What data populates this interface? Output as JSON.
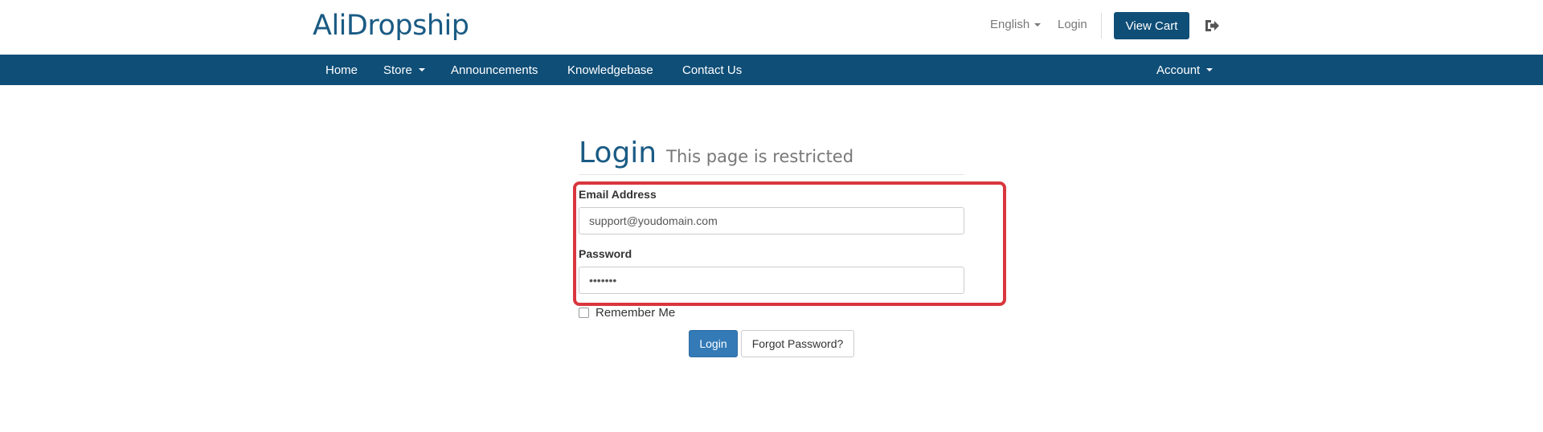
{
  "header": {
    "logo": "AliDropship",
    "language": "English",
    "login_link": "Login",
    "view_cart": "View Cart",
    "logout_icon": "sign-out-icon"
  },
  "nav": {
    "items": [
      {
        "label": "Home"
      },
      {
        "label": "Store",
        "dropdown": true
      },
      {
        "label": "Announcements"
      },
      {
        "label": "Knowledgebase"
      },
      {
        "label": "Contact Us"
      }
    ],
    "account": "Account"
  },
  "login": {
    "title": "Login",
    "subtitle": "This page is restricted",
    "email_label": "Email Address",
    "email_value": "support@youdomain.com",
    "password_label": "Password",
    "password_value": "•••••••",
    "remember_label": "Remember Me",
    "login_button": "Login",
    "forgot_button": "Forgot Password?"
  },
  "colors": {
    "brand": "#0f4e77",
    "primary_button": "#337ab7",
    "highlight": "#d9363e"
  }
}
